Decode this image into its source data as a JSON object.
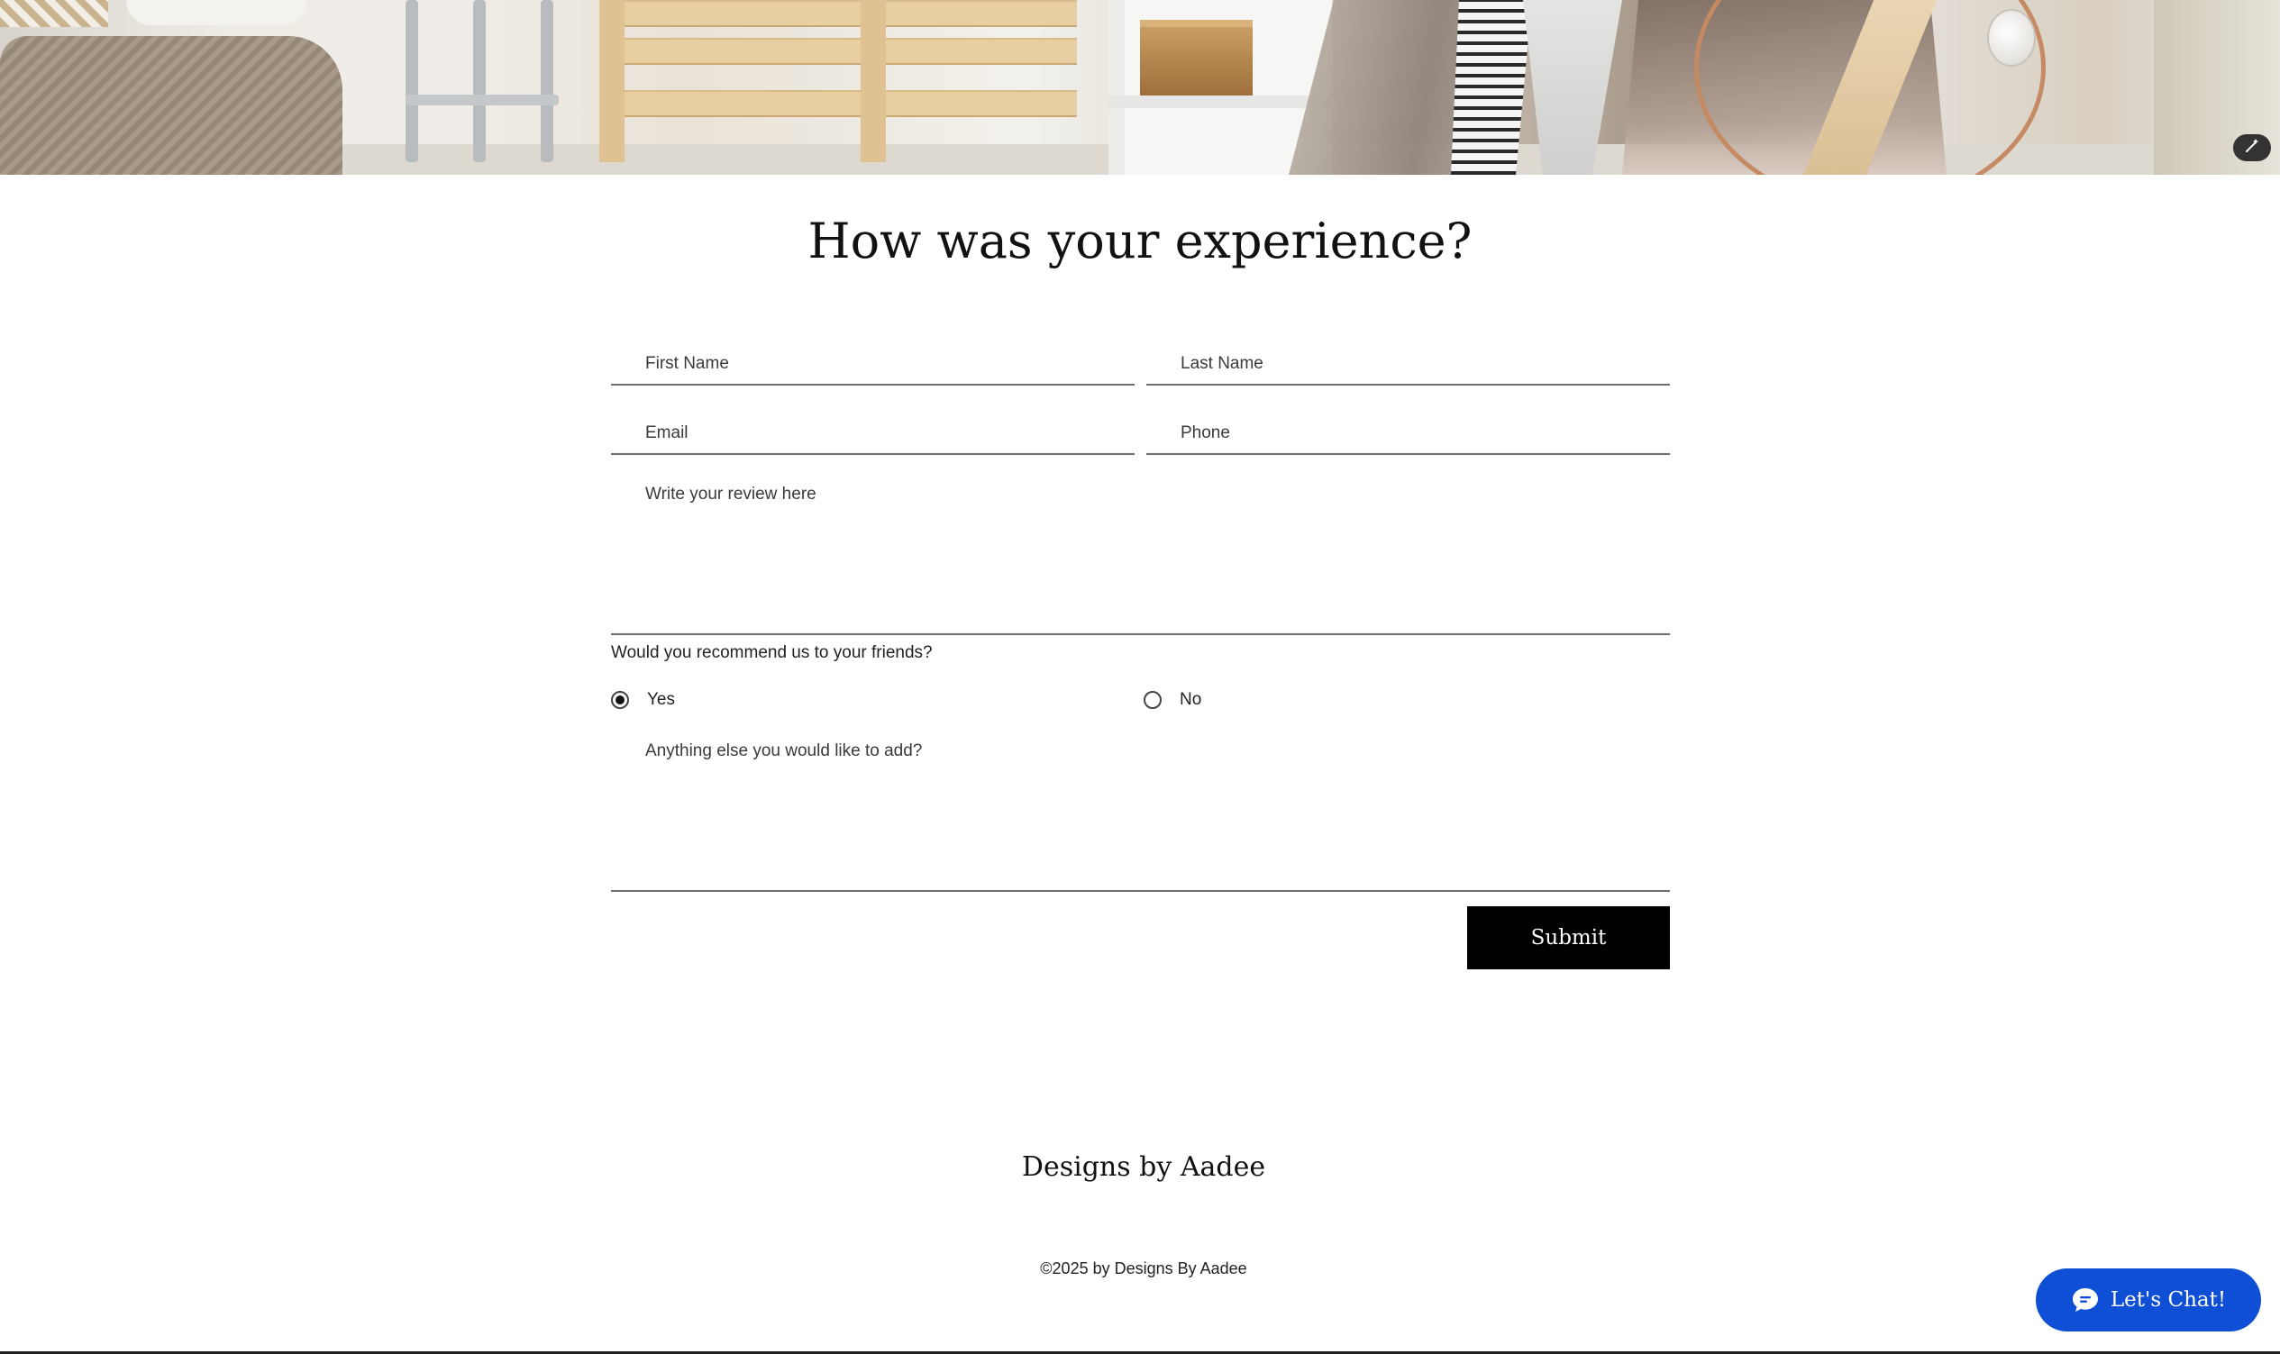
{
  "page": {
    "title": "How was your experience?"
  },
  "form": {
    "first_name_placeholder": "First Name",
    "last_name_placeholder": "Last Name",
    "email_placeholder": "Email",
    "phone_placeholder": "Phone",
    "review_placeholder": "Write your review here",
    "recommend_question": "Would you recommend us to your friends?",
    "recommend_options": [
      "Yes",
      "No"
    ],
    "recommend_selected": "Yes",
    "extra_placeholder": "Anything else you would like to add?",
    "submit_label": "Submit"
  },
  "footer": {
    "brand": "Designs by Aadee",
    "copyright": "©2025 by Designs By Aadee"
  },
  "chat": {
    "label": "Let's Chat!",
    "icon": "chat-bubble-icon",
    "color": "#0f4fd6"
  },
  "hero": {
    "tool_icon": "magic-wand-icon"
  }
}
